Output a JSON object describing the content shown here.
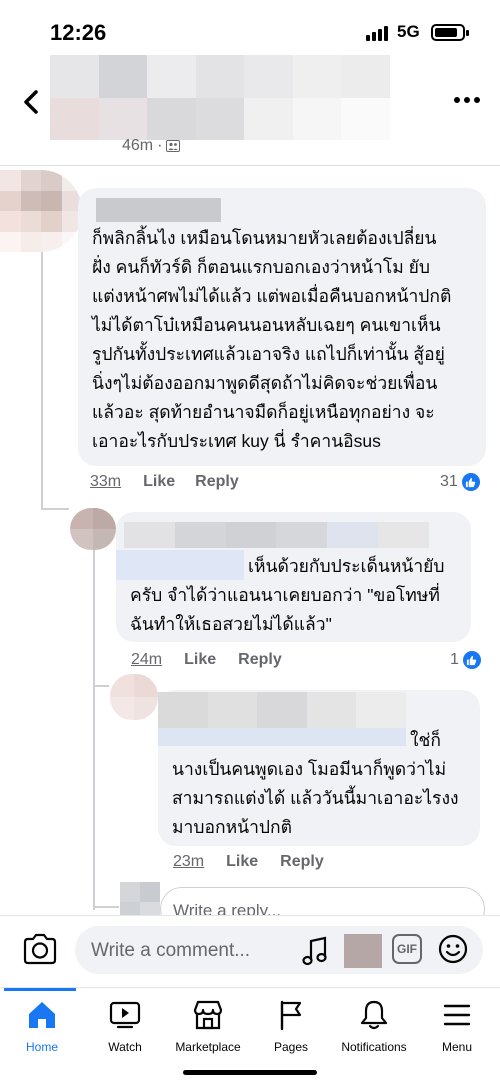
{
  "status_bar": {
    "time": "12:26",
    "network": "5G"
  },
  "post_header": {
    "time": "46m",
    "audience_icon": "friends-icon",
    "back_icon": "back-chevron-icon",
    "more_icon": "more-dots-icon"
  },
  "comments": [
    {
      "text_lines": [
        "ก็พลิกลิ้นไง เหมือนโดนหมายหัวเลยต้องเปลี่ยน",
        "ฝั่ง คนก็ทัวร์ดิ ก็ตอนแรกบอกเองว่าหน้าโม ยับ",
        "แต่งหน้าศพไม่ได้แล้ว แต่พอเมื่อคืนบอกหน้าปกติ",
        "ไม่ได้ตาโบ๋เหมือนคนนอนหลับเฉยๆ คนเขาเห็น",
        "รูปกันทั้งประเทศแล้วเอาจริง แถไปก็เท่านั้น สู้อยู่",
        "นิ่งๆไม่ต้องออกมาพูดดีสุดถ้าไม่คิดจะช่วยเพื่อน",
        "แล้วอะ   สุดท้ายอำนาจมืดก็อยู่เหนือทุกอย่าง จะ",
        "เอาอะไรกับประเทศ kuy นี่ รำคานอิsus"
      ],
      "time": "33m",
      "like_label": "Like",
      "reply_label": "Reply",
      "reactions": "31"
    },
    {
      "text_lines": [
        "เห็นด้วยกับประเด็นหน้ายับ",
        "ครับ จำได้ว่าแอนนาเคยบอกว่า \"ขอโทษที่",
        "ฉันทำให้เธอสวยไม่ได้แล้ว\""
      ],
      "time": "24m",
      "like_label": "Like",
      "reply_label": "Reply",
      "reactions": "1"
    },
    {
      "text_lines": [
        "ใช่ก็",
        "นางเป็นคนพูดเอง โมอมีนาก็พูดว่าไม่",
        "สามารถแต่งได้ แล้ววันนี้มาเอาอะไรงง",
        "มาบอกหน้าปกติ"
      ],
      "time": "23m",
      "like_label": "Like",
      "reply_label": "Reply"
    }
  ],
  "reply_box": {
    "placeholder": "Write a reply..."
  },
  "composer": {
    "placeholder": "Write a comment...",
    "gif_label": "GIF"
  },
  "tabs": [
    {
      "label": "Home",
      "icon": "home-icon",
      "active": true
    },
    {
      "label": "Watch",
      "icon": "watch-icon"
    },
    {
      "label": "Marketplace",
      "icon": "marketplace-icon"
    },
    {
      "label": "Pages",
      "icon": "pages-flag-icon"
    },
    {
      "label": "Notifications",
      "icon": "bell-icon"
    },
    {
      "label": "Menu",
      "icon": "menu-icon"
    }
  ],
  "colors": {
    "accent": "#1877f2",
    "bubble": "#f0f2f5",
    "secondary_text": "#65676b"
  }
}
